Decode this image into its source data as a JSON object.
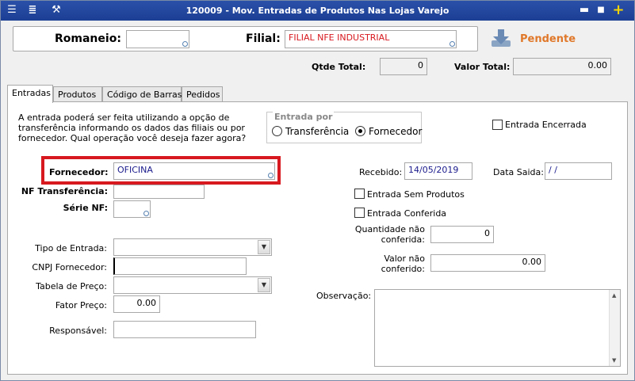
{
  "window": {
    "title": "120009 - Mov. Entradas de Produtos Nas Lojas Varejo"
  },
  "header": {
    "romaneio_label": "Romaneio:",
    "romaneio_value": "",
    "filial_label": "Filial:",
    "filial_value": "FILIAL NFE INDUSTRIAL",
    "status": "Pendente",
    "qtde_total_label": "Qtde Total:",
    "qtde_total_value": "0",
    "valor_total_label": "Valor Total:",
    "valor_total_value": "0.00"
  },
  "tabs": [
    {
      "label": "Entradas",
      "active": true
    },
    {
      "label": "Produtos",
      "active": false
    },
    {
      "label": "Código de Barras",
      "active": false
    },
    {
      "label": "Pedidos",
      "active": false
    }
  ],
  "entradas": {
    "info_line1": "A entrada poderá ser feita utilizando a opção de",
    "info_line2": "transferência informando os dados das filiais ou por",
    "info_line3": "fornecedor. Qual operação você deseja fazer agora?",
    "entrada_por_title": "Entrada por",
    "opt_transferencia": "Transferência",
    "opt_fornecedor": "Fornecedor",
    "entrada_encerrada": "Entrada Encerrada",
    "fornecedor_label": "Fornecedor:",
    "fornecedor_value": "OFICINA",
    "nf_transferencia_label": "NF Transferência:",
    "serie_nf_label": "Série NF:",
    "recebido_label": "Recebido:",
    "recebido_value": "14/05/2019",
    "data_saida_label": "Data Saida:",
    "data_saida_value": " / /",
    "entrada_sem_produtos": "Entrada Sem Produtos",
    "entrada_conferida": "Entrada Conferida",
    "qtd_nao_conferida_line1": "Quantidade não",
    "qtd_nao_conferida_line2": "conferida:",
    "qtd_nao_conferida_value": "0",
    "valor_nao_conferido_line1": "Valor não",
    "valor_nao_conferido_line2": "conferido:",
    "valor_nao_conferido_value": "0.00",
    "tipo_entrada_label": "Tipo de Entrada:",
    "cnpj_label": "CNPJ Fornecedor:",
    "tabela_preco_label": "Tabela de Preço:",
    "fator_preco_label": "Fator Preço:",
    "fator_preco_value": "0.00",
    "responsavel_label": "Responsável:",
    "observacao_label": "Observação:"
  },
  "colors": {
    "titlebar": "#1c3f94",
    "pendente": "#e0782a",
    "highlight": "#d7191f",
    "value_text": "#1a1a8c"
  }
}
